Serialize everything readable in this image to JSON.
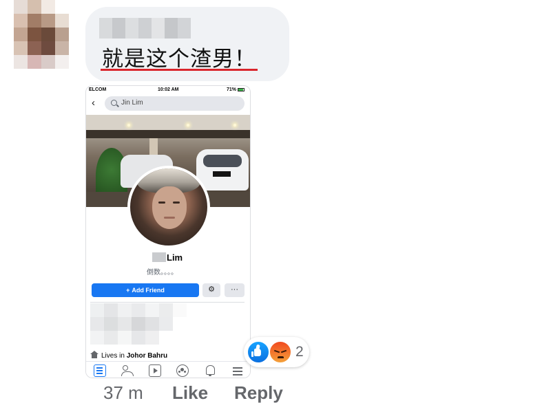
{
  "comment": {
    "text": "就是这个渣男！",
    "time": "37 m",
    "like_label": "Like",
    "reply_label": "Reply",
    "underline_color": "#d9252b"
  },
  "reactions": {
    "icons": [
      "like-icon",
      "angry-icon"
    ],
    "count": "2"
  },
  "screenshot": {
    "status_bar": {
      "carrier": "ELCOM",
      "time": "10:02 AM",
      "battery": "71%"
    },
    "search_query": "Jin Lim",
    "profile_name": "Lim",
    "bio": "倒数。。。。",
    "add_friend_label": "Add Friend",
    "more_label": "···",
    "lives_prefix": "Lives in",
    "lives_city": "Johor Bahru",
    "brand_color": "#1877f2"
  }
}
